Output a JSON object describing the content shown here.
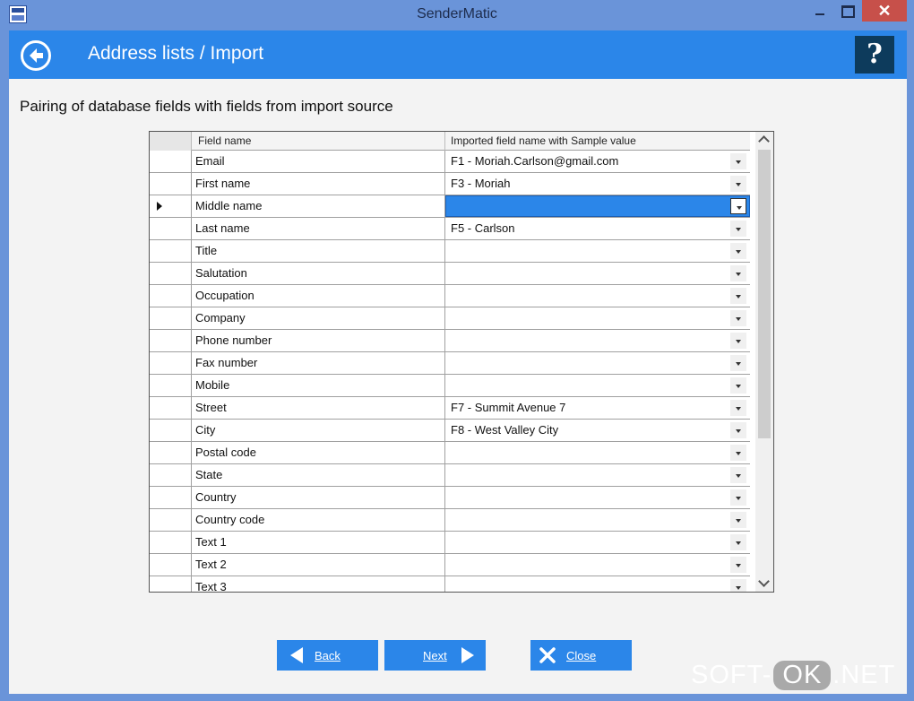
{
  "window": {
    "title": "SenderMatic",
    "close_glyph": "✕"
  },
  "header": {
    "title": "Address lists / Import",
    "help_label": "?"
  },
  "content": {
    "heading": "Pairing of database fields with fields from import source"
  },
  "grid": {
    "columns": [
      "Field name",
      "Imported field name with Sample value"
    ],
    "rows": [
      {
        "field": "Email",
        "imported": "F1 - Moriah.Carlson@gmail.com"
      },
      {
        "field": "First name",
        "imported": "F3 - Moriah"
      },
      {
        "field": "Middle name",
        "imported": "",
        "current": true,
        "selected": true
      },
      {
        "field": "Last name",
        "imported": "F5 - Carlson"
      },
      {
        "field": "Title",
        "imported": ""
      },
      {
        "field": "Salutation",
        "imported": ""
      },
      {
        "field": "Occupation",
        "imported": ""
      },
      {
        "field": "Company",
        "imported": ""
      },
      {
        "field": "Phone number",
        "imported": ""
      },
      {
        "field": "Fax number",
        "imported": ""
      },
      {
        "field": "Mobile",
        "imported": ""
      },
      {
        "field": "Street",
        "imported": "F7 - Summit Avenue 7"
      },
      {
        "field": "City",
        "imported": "F8 - West Valley City"
      },
      {
        "field": "Postal code",
        "imported": ""
      },
      {
        "field": "State",
        "imported": ""
      },
      {
        "field": "Country",
        "imported": ""
      },
      {
        "field": "Country code",
        "imported": ""
      },
      {
        "field": "Text 1",
        "imported": ""
      },
      {
        "field": "Text 2",
        "imported": ""
      },
      {
        "field": "Text 3",
        "imported": ""
      }
    ]
  },
  "buttons": {
    "back": "Back",
    "next": "Next",
    "close": "Close"
  },
  "watermark": {
    "left": "SOFT-",
    "middle": "OK",
    "right": ".NET"
  },
  "colors": {
    "accent": "#2b86e9",
    "window_frame": "#6a94d9",
    "help_button": "#0d3b5c",
    "close_button": "#c7504a"
  }
}
